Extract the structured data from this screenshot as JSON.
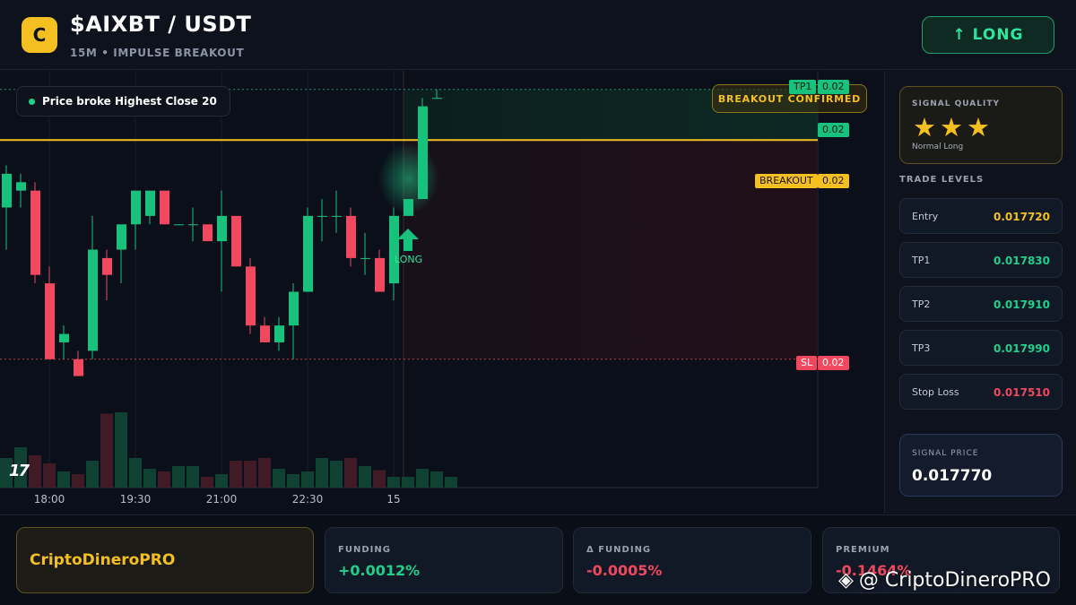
{
  "header": {
    "logo_letter": "C",
    "pair": "$AIXBT / USDT",
    "subtitle": "15M • IMPULSE BREAKOUT",
    "action_label": "↑ LONG"
  },
  "chart": {
    "info_pill": "Price broke Highest Close 20",
    "breakout_badge": "BREAKOUT CONFIRMED",
    "tags": {
      "tp1_label": "TP1",
      "tp1_value": "0.02",
      "price_value": "0.02",
      "breakout_label": "BREAKOUT",
      "breakout_value": "0.02",
      "sl_label": "SL",
      "sl_value": "0.02"
    },
    "signal_marker": "LONG",
    "tv_logo": "17",
    "x_axis_labels": [
      "18:00",
      "19:30",
      "21:00",
      "22:30",
      "15"
    ],
    "colors": {
      "up": "#17c27d",
      "down": "#f0485e",
      "breakout": "#f4c021"
    }
  },
  "chart_data": {
    "type": "candlestick",
    "x_ticks": [
      "18:00",
      "19:30",
      "21:00",
      "22:30",
      "15"
    ],
    "levels": {
      "tp1": 0.01783,
      "breakout": 0.01777,
      "stop_loss": 0.01751,
      "entry": 0.01772
    },
    "candles": [
      {
        "o": 0.01769,
        "h": 0.01774,
        "l": 0.01764,
        "c": 0.01773
      },
      {
        "o": 0.01771,
        "h": 0.01773,
        "l": 0.01769,
        "c": 0.01772
      },
      {
        "o": 0.01771,
        "h": 0.01772,
        "l": 0.0176,
        "c": 0.01761
      },
      {
        "o": 0.0176,
        "h": 0.01762,
        "l": 0.01751,
        "c": 0.01751
      },
      {
        "o": 0.01753,
        "h": 0.01755,
        "l": 0.01751,
        "c": 0.01754
      },
      {
        "o": 0.01751,
        "h": 0.01752,
        "l": 0.01749,
        "c": 0.01749
      },
      {
        "o": 0.01752,
        "h": 0.01768,
        "l": 0.01751,
        "c": 0.01764
      },
      {
        "o": 0.01763,
        "h": 0.01764,
        "l": 0.01758,
        "c": 0.01761
      },
      {
        "o": 0.01764,
        "h": 0.01766,
        "l": 0.0176,
        "c": 0.01767
      },
      {
        "o": 0.01767,
        "h": 0.01771,
        "l": 0.01764,
        "c": 0.01771
      },
      {
        "o": 0.01768,
        "h": 0.01771,
        "l": 0.01767,
        "c": 0.01771
      },
      {
        "o": 0.01771,
        "h": 0.01771,
        "l": 0.01767,
        "c": 0.01767
      },
      {
        "o": 0.01767,
        "h": 0.01767,
        "l": 0.01767,
        "c": 0.01767
      },
      {
        "o": 0.01767,
        "h": 0.01769,
        "l": 0.01765,
        "c": 0.01767
      },
      {
        "o": 0.01767,
        "h": 0.01767,
        "l": 0.01765,
        "c": 0.01765
      },
      {
        "o": 0.01765,
        "h": 0.01771,
        "l": 0.01759,
        "c": 0.01768
      },
      {
        "o": 0.01768,
        "h": 0.01768,
        "l": 0.01762,
        "c": 0.01762
      },
      {
        "o": 0.01762,
        "h": 0.01763,
        "l": 0.01754,
        "c": 0.01755
      },
      {
        "o": 0.01755,
        "h": 0.01756,
        "l": 0.01753,
        "c": 0.01753
      },
      {
        "o": 0.01753,
        "h": 0.01756,
        "l": 0.01752,
        "c": 0.01755
      },
      {
        "o": 0.01755,
        "h": 0.0176,
        "l": 0.01751,
        "c": 0.01759
      },
      {
        "o": 0.01759,
        "h": 0.01769,
        "l": 0.01759,
        "c": 0.01768
      },
      {
        "o": 0.01768,
        "h": 0.0177,
        "l": 0.01765,
        "c": 0.01768
      },
      {
        "o": 0.01768,
        "h": 0.01771,
        "l": 0.01766,
        "c": 0.01768
      },
      {
        "o": 0.01768,
        "h": 0.01769,
        "l": 0.01762,
        "c": 0.01763
      },
      {
        "o": 0.01763,
        "h": 0.01766,
        "l": 0.01761,
        "c": 0.01763
      },
      {
        "o": 0.01763,
        "h": 0.01764,
        "l": 0.01759,
        "c": 0.01759
      },
      {
        "o": 0.0176,
        "h": 0.01769,
        "l": 0.01758,
        "c": 0.01768
      },
      {
        "o": 0.01768,
        "h": 0.0177,
        "l": 0.01768,
        "c": 0.0177
      },
      {
        "o": 0.0177,
        "h": 0.01782,
        "l": 0.0177,
        "c": 0.01781
      },
      {
        "o": 0.01782,
        "h": 0.01783,
        "l": 0.01782,
        "c": 0.01782
      }
    ],
    "volumes": [
      22,
      30,
      24,
      18,
      12,
      10,
      20,
      55,
      56,
      22,
      14,
      12,
      16,
      16,
      8,
      10,
      20,
      20,
      22,
      14,
      10,
      12,
      22,
      20,
      22,
      16,
      13,
      8,
      8,
      14,
      12,
      8
    ]
  },
  "side": {
    "quality_caption": "SIGNAL QUALITY",
    "stars": "★★★",
    "quality_note": "Normal Long",
    "levels_title": "TRADE LEVELS",
    "levels": [
      {
        "name": "Entry",
        "value": "0.017720",
        "color": "#f4c021"
      },
      {
        "name": "TP1",
        "value": "0.017830",
        "color": "#1fd08a"
      },
      {
        "name": "TP2",
        "value": "0.017910",
        "color": "#1fd08a"
      },
      {
        "name": "TP3",
        "value": "0.017990",
        "color": "#1fd08a"
      },
      {
        "name": "Stop Loss",
        "value": "0.017510",
        "color": "#f0485e"
      }
    ],
    "signal_caption": "SIGNAL PRICE",
    "signal_price": "0.017770"
  },
  "footer": {
    "brand": "CriptoDineroPRO",
    "stats": [
      {
        "label": "FUNDING",
        "value": "+0.0012%",
        "color": "#1fd08a"
      },
      {
        "label": "Δ FUNDING",
        "value": "-0.0005%",
        "color": "#f0485e"
      },
      {
        "label": "PREMIUM",
        "value": "-0.1464%",
        "color": "#f0485e"
      }
    ],
    "watermark": "@ CriptoDineroPRO"
  }
}
